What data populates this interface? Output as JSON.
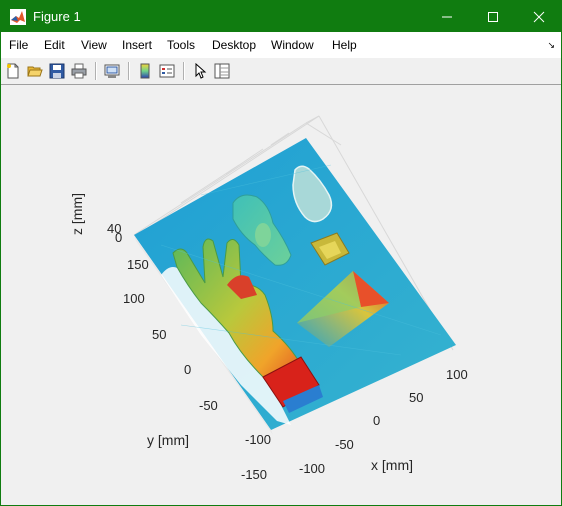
{
  "window": {
    "title": "Figure 1",
    "accent_color": "#107c10",
    "controls": [
      "minimize-icon",
      "maximize-icon",
      "close-icon"
    ]
  },
  "menu": {
    "items": [
      "File",
      "Edit",
      "View",
      "Insert",
      "Tools",
      "Desktop",
      "Window",
      "Help"
    ]
  },
  "toolbar": {
    "buttons": [
      "new-figure-icon",
      "open-file-icon",
      "save-icon",
      "print-icon",
      "link-plot-icon",
      "colorbar-icon",
      "legend-icon",
      "pointer-icon",
      "property-inspector-icon"
    ]
  },
  "plot": {
    "x_label": "x [mm]",
    "y_label": "y [mm]",
    "z_label": "z [mm]",
    "x_ticks": [
      "-100",
      "-50",
      "0",
      "50",
      "100"
    ],
    "y_ticks": [
      "150",
      "100",
      "50",
      "0",
      "-50",
      "-100",
      "-150"
    ],
    "z_ticks": [
      "40",
      "0"
    ],
    "colormap": "jet"
  }
}
